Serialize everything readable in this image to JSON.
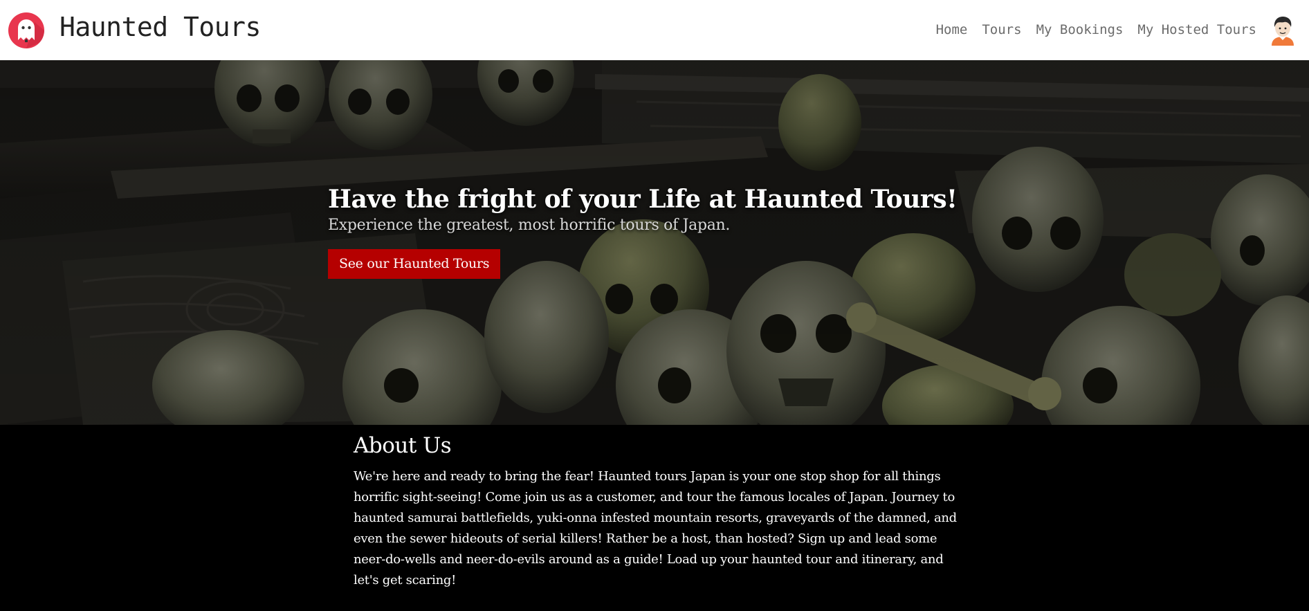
{
  "header": {
    "site_title": "Haunted Tours",
    "logo_icon": "ghost-logo-icon",
    "nav": [
      {
        "label": "Home"
      },
      {
        "label": "Tours"
      },
      {
        "label": "My Bookings"
      },
      {
        "label": "My Hosted Tours"
      }
    ],
    "avatar_icon": "user-avatar-icon"
  },
  "hero": {
    "background": "skulls-photo",
    "title": "Have the fright of your Life at Haunted Tours!",
    "subtitle": "Experience the greatest, most horrific tours of Japan.",
    "cta_label": "See our Haunted Tours"
  },
  "about": {
    "heading": "About Us",
    "body": "We're here and ready to bring the fear! Haunted tours Japan is your one stop shop for all things horrific sight-seeing! Come join us as a customer, and tour the famous locales of Japan. Journey to haunted samurai battlefields, yuki-onna infested mountain resorts, graveyards of the damned, and even the sewer hideouts of serial killers! Rather be a host, than hosted? Sign up and lead some neer-do-wells and neer-do-evils around as a guide! Load up your haunted tour and itinerary, and let's get scaring!"
  },
  "colors": {
    "header_bg": "#ffffff",
    "logo_red": "#e8364e",
    "cta_red": "#b50000",
    "page_bg": "#000000",
    "nav_text": "#6b6b6b"
  }
}
